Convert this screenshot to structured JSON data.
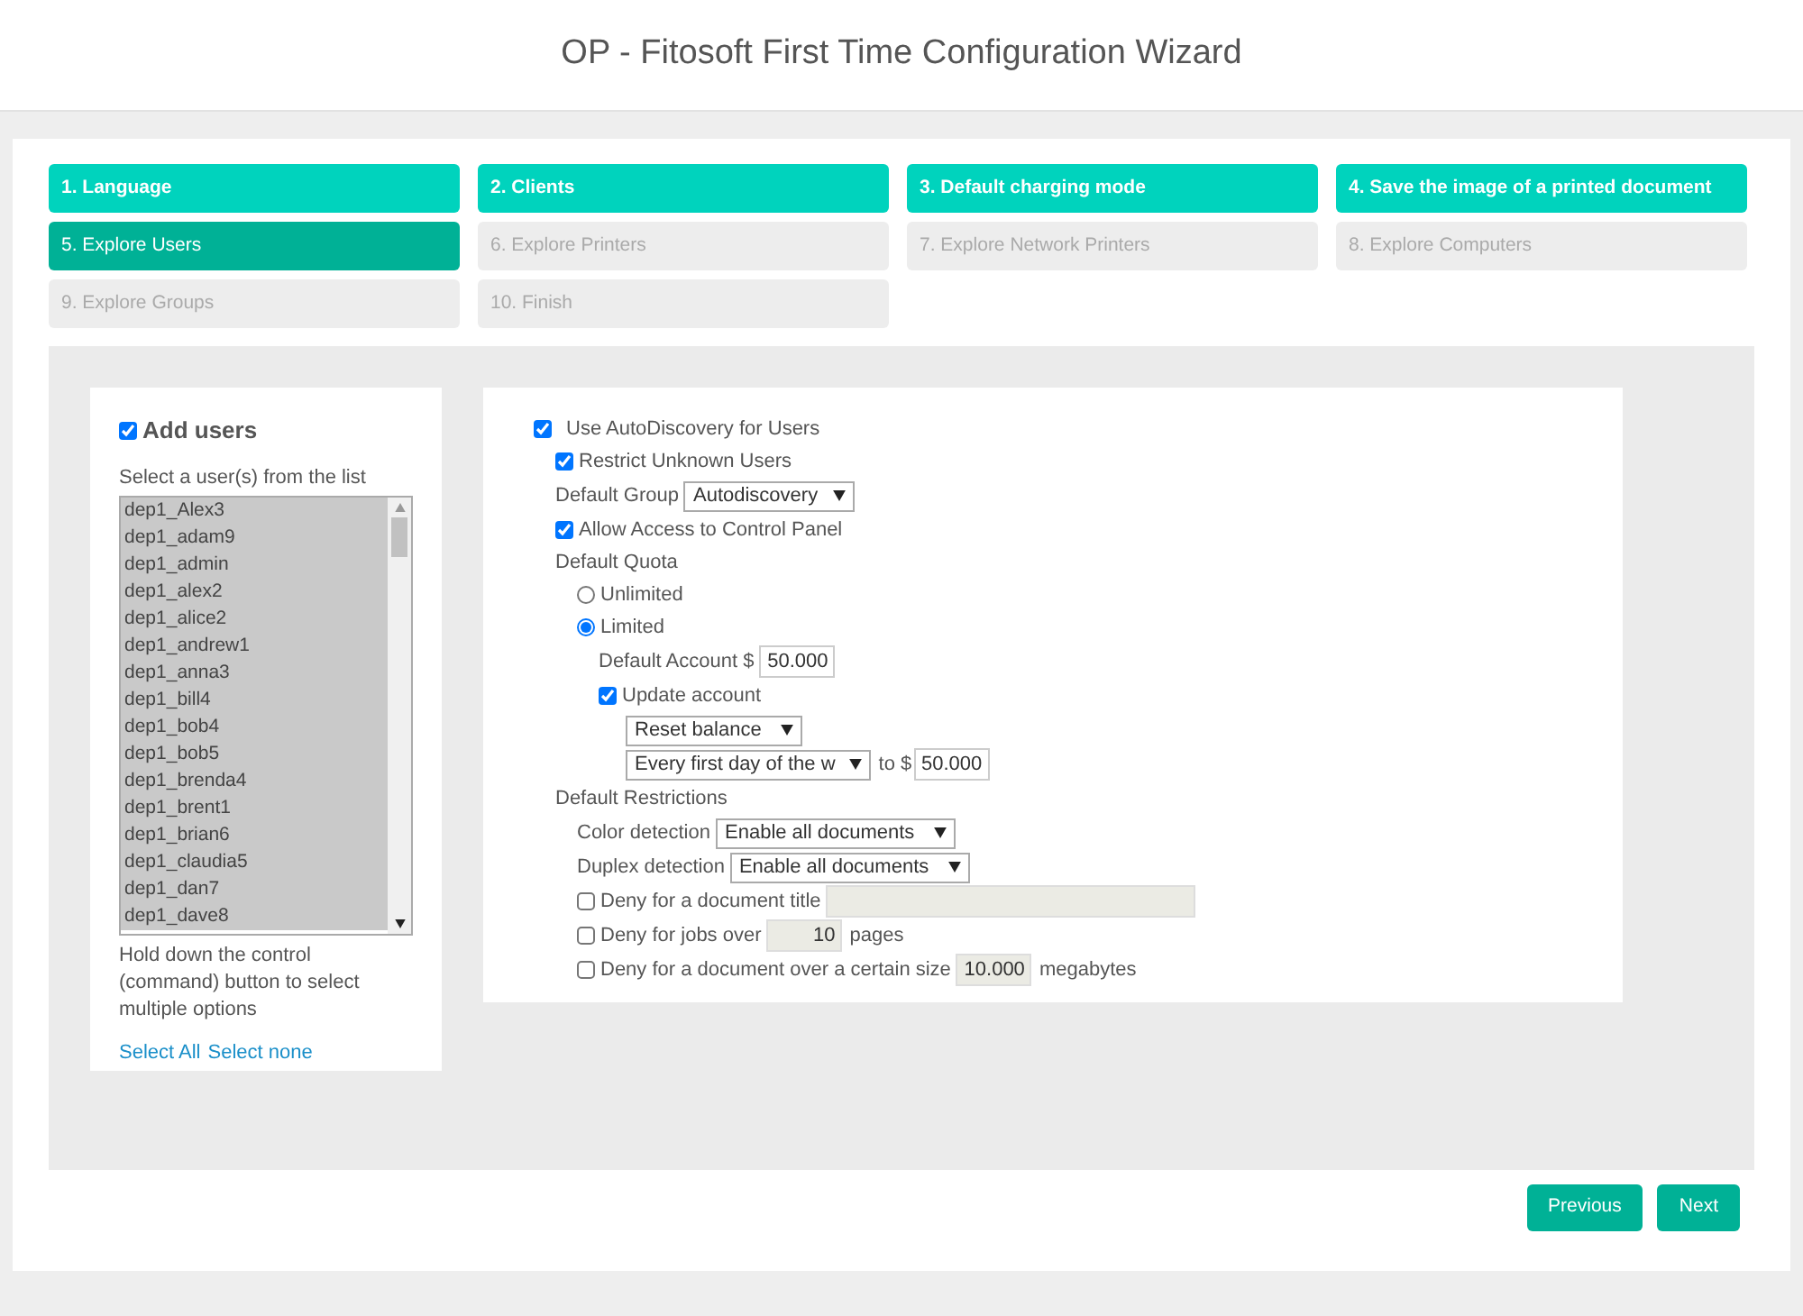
{
  "window": {
    "title": "OP - Fitosoft First Time Configuration Wizard"
  },
  "steps": [
    {
      "label": "1. Language",
      "done": true,
      "selected": false
    },
    {
      "label": "2. Clients",
      "done": true,
      "selected": false
    },
    {
      "label": "3. Default charging mode",
      "done": true,
      "selected": false
    },
    {
      "label": "4. Save the image of a printed document",
      "done": true,
      "selected": false
    },
    {
      "label": "5. Explore Users",
      "done": false,
      "selected": true
    },
    {
      "label": "6. Explore Printers",
      "done": false,
      "selected": false
    },
    {
      "label": "7. Explore Network Printers",
      "done": false,
      "selected": false
    },
    {
      "label": "8. Explore Computers",
      "done": false,
      "selected": false
    },
    {
      "label": "9. Explore Groups",
      "done": false,
      "selected": false
    },
    {
      "label": "10. Finish",
      "done": false,
      "selected": false
    }
  ],
  "users_panel": {
    "title": "Add users",
    "checked": true,
    "list_label": "Select a user(s) from the list",
    "users": [
      {
        "name": "dep1_Alex3",
        "selected": true
      },
      {
        "name": "dep1_adam9",
        "selected": true
      },
      {
        "name": "dep1_admin",
        "selected": true
      },
      {
        "name": "dep1_alex2",
        "selected": true
      },
      {
        "name": "dep1_alice2",
        "selected": true
      },
      {
        "name": "dep1_andrew1",
        "selected": true
      },
      {
        "name": "dep1_anna3",
        "selected": true
      },
      {
        "name": "dep1_bill4",
        "selected": true
      },
      {
        "name": "dep1_bob4",
        "selected": true
      },
      {
        "name": "dep1_bob5",
        "selected": true
      },
      {
        "name": "dep1_brenda4",
        "selected": true
      },
      {
        "name": "dep1_brent1",
        "selected": true
      },
      {
        "name": "dep1_brian6",
        "selected": true
      },
      {
        "name": "dep1_claudia5",
        "selected": true
      },
      {
        "name": "dep1_dan7",
        "selected": true
      },
      {
        "name": "dep1_dave8",
        "selected": true
      }
    ],
    "hint": "Hold down the control (command) button to select multiple options",
    "links": [
      "Select All",
      "Select none"
    ]
  },
  "settings": [
    {
      "kind": "checkbox",
      "label": "Use AutoDiscovery for Users",
      "checked": true,
      "children": [
        {
          "kind": "checkbox",
          "label": "Restrict Unknown Users",
          "checked": true
        },
        {
          "kind": "select",
          "label": "Default Group",
          "value": "Autodiscovery"
        },
        {
          "kind": "checkbox",
          "label": "Allow Access to Control Panel",
          "checked": true
        },
        {
          "kind": "heading",
          "label": "Default Quota",
          "children": [
            {
              "kind": "radio",
              "label": "Unlimited",
              "selected": false
            },
            {
              "kind": "radio",
              "label": "Limited",
              "selected": true,
              "children": [
                {
                  "kind": "input",
                  "label": "Default Account $",
                  "value": "50.000"
                },
                {
                  "kind": "checkbox",
                  "label": "Update account",
                  "checked": true,
                  "children": [
                    {
                      "kind": "select",
                      "value": "Reset balance"
                    },
                    {
                      "kind": "select-input",
                      "value": "Every first day of the w",
                      "between": "to $",
                      "input": "50.000"
                    }
                  ]
                }
              ]
            }
          ]
        },
        {
          "kind": "heading",
          "label": "Default Restrictions",
          "children": [
            {
              "kind": "select",
              "label": "Color detection",
              "value": "Enable all documents"
            },
            {
              "kind": "select",
              "label": "Duplex detection",
              "value": "Enable all documents"
            },
            {
              "kind": "checkbox-input",
              "label": "Deny for a document title",
              "checked": false,
              "disabled": true
            },
            {
              "kind": "checkbox-input",
              "label": "Deny for jobs over",
              "checked": false,
              "disabled": true,
              "value": "10",
              "suffix": "pages"
            },
            {
              "kind": "checkbox-input",
              "label": "Deny for a document over a certain size",
              "checked": false,
              "disabled": true,
              "value": "10.000",
              "suffix": "megabytes"
            }
          ]
        }
      ]
    }
  ],
  "buttons": [
    "Previous",
    "Next"
  ]
}
